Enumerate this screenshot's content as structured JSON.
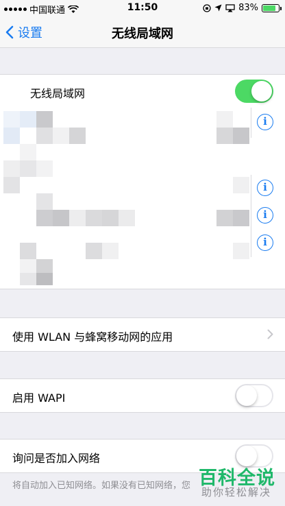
{
  "status_bar": {
    "carrier": "中国联通",
    "time": "11:50",
    "battery_percent": "83%",
    "battery_level": 0.83,
    "icons": [
      "signal-icon",
      "wifi-icon",
      "orientation-lock-icon",
      "location-icon",
      "airplay-icon",
      "battery-icon"
    ]
  },
  "nav": {
    "back_label": "设置",
    "title": "无线局域网"
  },
  "wifi_toggle": {
    "label": "无线局域网",
    "on": true
  },
  "networks": {
    "info_symbol": "i"
  },
  "wlan_apps": {
    "label": "使用 WLAN 与蜂窝移动网的应用"
  },
  "wapi": {
    "label": "启用 WAPI",
    "on": false
  },
  "ask_join": {
    "label": "询问是否加入网络",
    "on": false
  },
  "footnote": "将自动加入已知网络。如果没有已知网络，您",
  "watermark": {
    "brand": "百科全说",
    "tagline": "助你轻松解决"
  },
  "colors": {
    "accent": "#1a7cf0",
    "toggle_on": "#4cd964",
    "watermark": "#1fb86a"
  }
}
